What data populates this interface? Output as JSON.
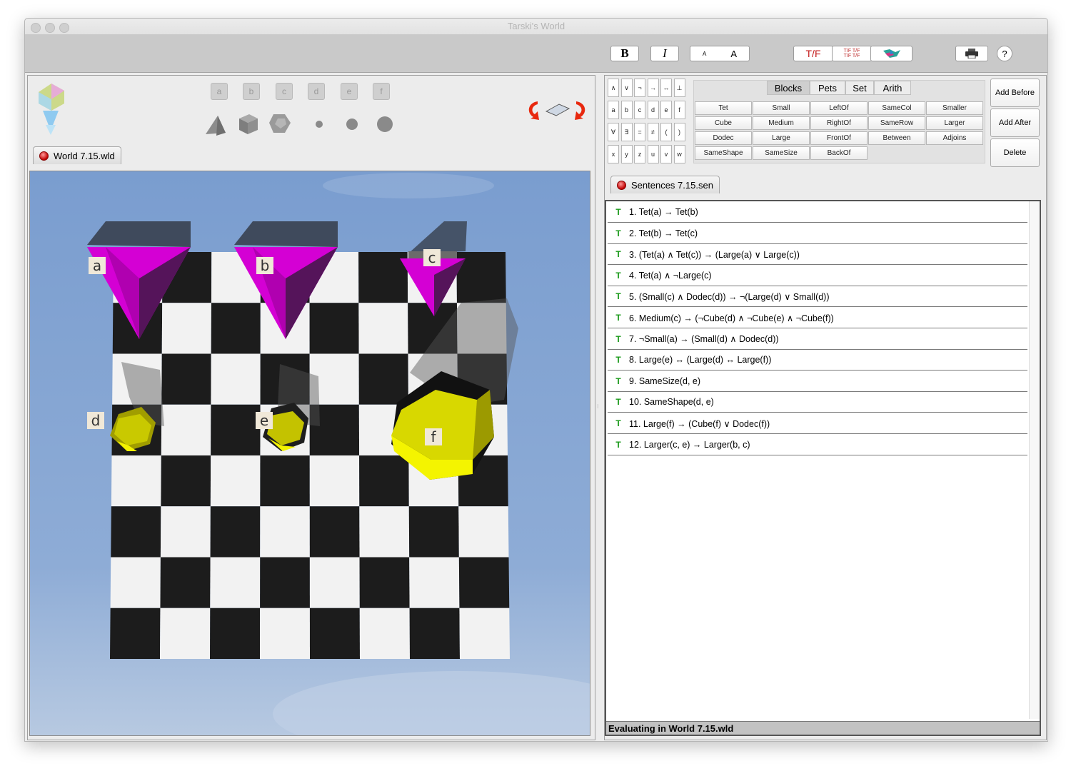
{
  "window": {
    "title": "Tarski's World"
  },
  "toolbar": {
    "bold_label": "B",
    "italic_label": "I",
    "font_small_label": "A",
    "font_large_label": "A",
    "tf_label": "T/F",
    "tf_all_label_top": "T/F T/F",
    "tf_all_label_bottom": "T/F T/F"
  },
  "palette": {
    "block_names": [
      "a",
      "b",
      "c",
      "d",
      "e",
      "f"
    ]
  },
  "world_tab": {
    "label": "World 7.15.wld"
  },
  "world_labels": {
    "a": "a",
    "b": "b",
    "c": "c",
    "d": "d",
    "e": "e",
    "f": "f"
  },
  "keyboard": {
    "row1": [
      "∧",
      "∨",
      "¬",
      "→",
      "↔",
      "⊥"
    ],
    "row2": [
      "a",
      "b",
      "c",
      "d",
      "e",
      "f"
    ],
    "row3": [
      "∀",
      "∃",
      "=",
      "≠",
      "(",
      ")"
    ],
    "row4": [
      "x",
      "y",
      "z",
      "u",
      "v",
      "w"
    ]
  },
  "predicate_tabs": [
    "Blocks",
    "Pets",
    "Set",
    "Arith"
  ],
  "predicates": [
    [
      "Tet",
      "Small",
      "LeftOf",
      "SameCol",
      "Smaller"
    ],
    [
      "Cube",
      "Medium",
      "RightOf",
      "SameRow",
      "Larger"
    ],
    [
      "Dodec",
      "Large",
      "FrontOf",
      "Between",
      "Adjoins"
    ],
    [
      "SameShape",
      "SameSize",
      "BackOf",
      "",
      ""
    ]
  ],
  "side_buttons": {
    "add_before": "Add Before",
    "add_after": "Add After",
    "delete": "Delete"
  },
  "sentences_tab": {
    "label": "Sentences 7.15.sen"
  },
  "sentences": [
    {
      "truth": "T",
      "text": "1.  Tet(a) → Tet(b)"
    },
    {
      "truth": "T",
      "text": "2.  Tet(b) → Tet(c)"
    },
    {
      "truth": "T",
      "text": "3.  (Tet(a) ∧ Tet(c)) → (Large(a) ∨ Large(c))"
    },
    {
      "truth": "T",
      "text": "4.  Tet(a) ∧ ¬Large(c)"
    },
    {
      "truth": "T",
      "text": "5.  (Small(c) ∧ Dodec(d)) → ¬(Large(d) ∨ Small(d))"
    },
    {
      "truth": "T",
      "text": "6.  Medium(c) → (¬Cube(d) ∧ ¬Cube(e) ∧ ¬Cube(f))"
    },
    {
      "truth": "T",
      "text": "7.  ¬Small(a) → (Small(d) ∧ Dodec(d))"
    },
    {
      "truth": "T",
      "text": "8.  Large(e) ↔ (Large(d) ↔ Large(f))"
    },
    {
      "truth": "T",
      "text": "9.  SameSize(d, e)"
    },
    {
      "truth": "T",
      "text": "10.  SameShape(d, e)"
    },
    {
      "truth": "T",
      "text": "11.  Large(f) → (Cube(f) ∨ Dodec(f))"
    },
    {
      "truth": "T",
      "text": "12.  Larger(c, e) → Larger(b, c)"
    }
  ],
  "status": {
    "text": "Evaluating in World 7.15.wld"
  },
  "colors": {
    "tet": "#d400d4",
    "dodec": "#d8d800",
    "sky": "#7ea0cf",
    "true_green": "#1a9a1a"
  }
}
